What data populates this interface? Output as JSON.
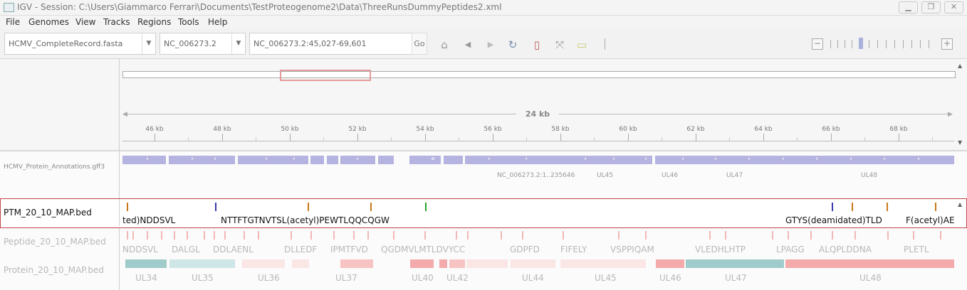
{
  "window": {
    "title": "IGV - Session: C:\\Users\\Giammarco Ferrari\\Documents\\TestProteogenome2\\Data\\ThreeRunsDummyPeptides2.xml"
  },
  "menu": [
    "File",
    "Genomes",
    "View",
    "Tracks",
    "Regions",
    "Tools",
    "Help"
  ],
  "toolbar": {
    "genome": "HCMV_CompleteRecord.fasta",
    "chromosome": "NC_006273.2",
    "locus": "NC_006273.2:45,027-69,601",
    "go_label": "Go"
  },
  "ruler": {
    "span_label": "24 kb",
    "ticks": [
      "46 kb",
      "48 kb",
      "50 kb",
      "52 kb",
      "54 kb",
      "56 kb",
      "58 kb",
      "60 kb",
      "62 kb",
      "64 kb",
      "66 kb",
      "68 kb"
    ]
  },
  "tracks": {
    "gff": {
      "name": "HCMV_Protein_Annotations.gff3",
      "labels": [
        "NC_006273.2:1..235646",
        "UL45",
        "UL46",
        "UL47",
        "UL48"
      ]
    },
    "ptm": {
      "name": "PTM_20_10_MAP.bed",
      "labels": [
        "ted)NDDSVL",
        "NTTFTGTNVTSL(acetyl)PEWTLQQCQGW",
        "GTYS(deamidated)TLD",
        "F(acetyl)AE"
      ]
    },
    "peptide": {
      "name": "Peptide_20_10_MAP.bed",
      "labels": [
        "NDDSVL",
        "DALGL",
        "DDLAENL",
        "DLLEDF",
        "IPMTFVD",
        "QGDMVLMTLDVYCC",
        "GDPFD",
        "FIFELY",
        "VSPPIQAM",
        "VLEDHLHTP",
        "LPAGG",
        "ALQPLDDNA",
        "PLETL"
      ]
    },
    "protein": {
      "name": "Protein_20_10_MAP.bed",
      "labels": [
        "UL34",
        "UL35",
        "UL36",
        "UL37",
        "UL40",
        "UL42",
        "UL44",
        "UL45",
        "UL46",
        "UL47",
        "UL48"
      ]
    }
  },
  "colors": {
    "gff": "#b5b3df",
    "ptm_border": "#c0464c",
    "ptm_blue": "#3b3bb0",
    "ptm_orange": "#c8781a",
    "ptm_green": "#2aa52a",
    "peptide": "#f3b7b7",
    "protein_teal": "#bcdcdc",
    "protein_pink": "#f7c3c3"
  },
  "icons": [
    "home-icon",
    "back-icon",
    "forward-icon",
    "refresh-icon",
    "roi-icon",
    "fit-icon",
    "popup-icon"
  ]
}
